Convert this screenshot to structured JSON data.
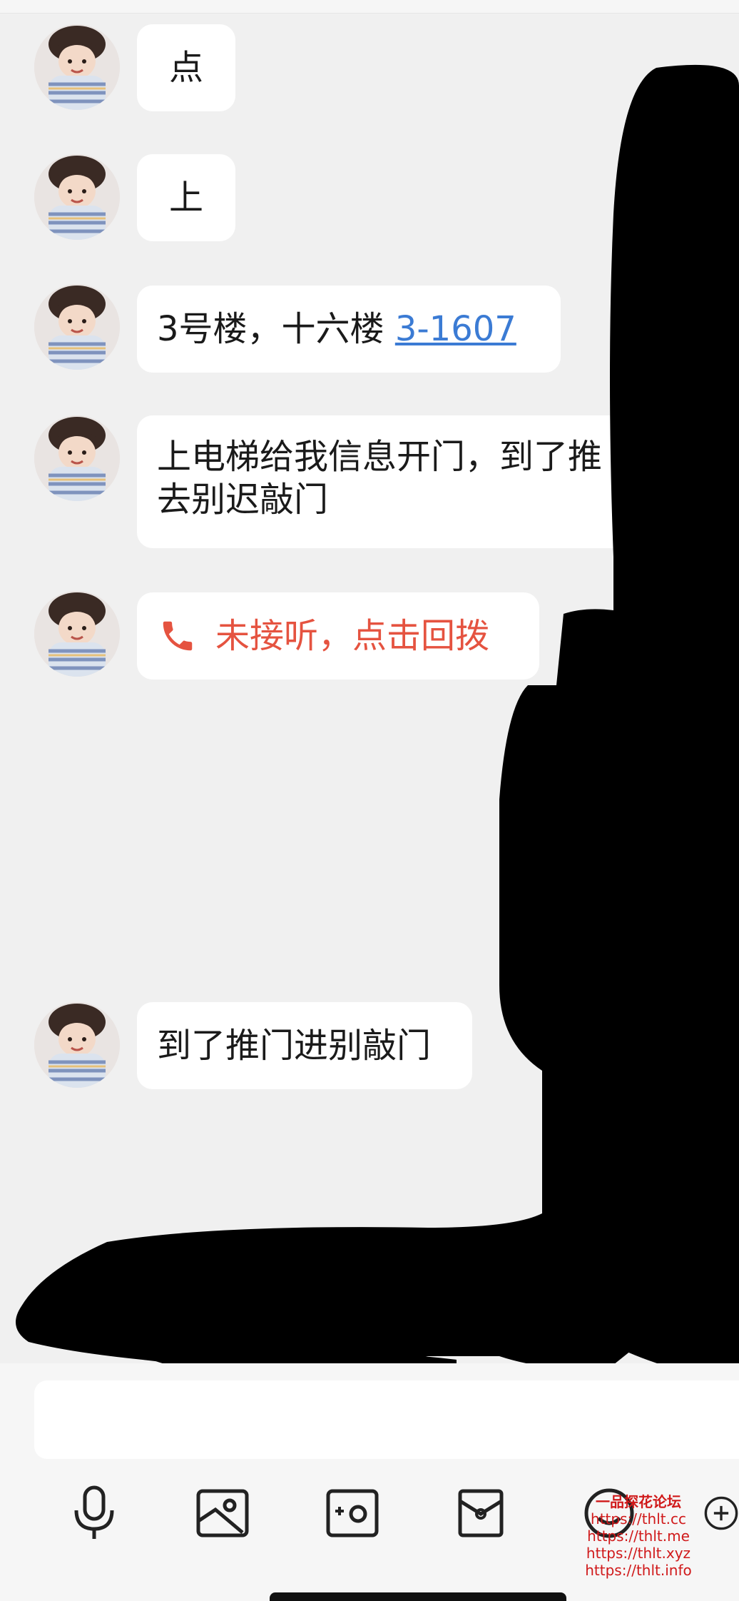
{
  "messages": [
    {
      "text": "点"
    },
    {
      "text": "上"
    },
    {
      "text": "3号楼，十六楼 ",
      "link": "3-1607"
    },
    {
      "text_line1": "上电梯给我信息开门，到了推",
      "text_line2": "去别迟敲门"
    },
    {
      "call_text": "未接听，点击回拨",
      "icon": "phone-icon"
    },
    {
      "text": "到了推门进别敲门"
    }
  ],
  "input": {
    "placeholder": ""
  },
  "toolbar": {
    "icons": [
      "microphone-icon",
      "image-icon",
      "camera-icon",
      "red-packet-icon",
      "emoji-icon",
      "plus-icon"
    ]
  },
  "watermark": {
    "brand": "一品探花论坛",
    "lines": [
      "https://thlt.cc",
      "https://thlt.me",
      "https://thlt.xyz",
      "https://thlt.info"
    ]
  },
  "colors": {
    "background": "#f0f0f0",
    "bubble": "#ffffff",
    "link": "#3b7bd4",
    "missed_call": "#e55340",
    "watermark": "#d0191a"
  }
}
